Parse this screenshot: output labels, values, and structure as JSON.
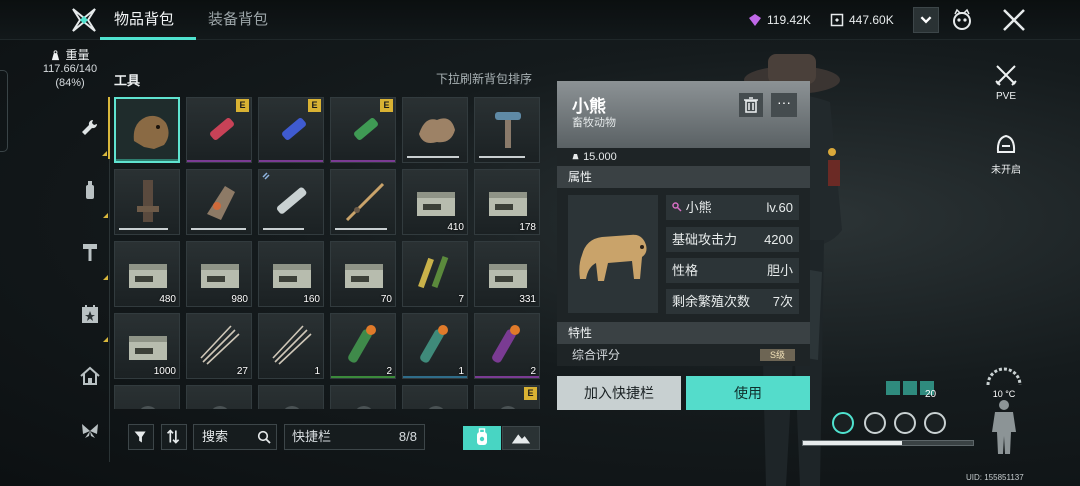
{
  "header": {
    "tabs": [
      "物品背包",
      "装备背包"
    ],
    "active_tab": 0,
    "currency1": "119.42K",
    "currency2": "447.60K"
  },
  "sidebar": {
    "weight_label": "重量",
    "weight_value": "117.66/140",
    "weight_percent": "(84%)",
    "categories": [
      "wrench-icon",
      "bottle-icon",
      "hammer-icon",
      "calendar-star-icon",
      "house-icon",
      "butterfly-icon"
    ],
    "active_category": 0
  },
  "inventory": {
    "section_title": "工具",
    "refresh_hint": "下拉刷新背包排序",
    "slots": [
      {
        "icon": "bear-head",
        "selected": true,
        "rarity": "#2f7d6f"
      },
      {
        "icon": "vial-red",
        "badge": "E",
        "rarity": "#7a3b93"
      },
      {
        "icon": "vial-blue",
        "badge": "E",
        "rarity": "#7a3b93"
      },
      {
        "icon": "vial-green",
        "badge": "E",
        "rarity": "#7a3b93"
      },
      {
        "icon": "fur-pelt",
        "durability": 0.9
      },
      {
        "icon": "pickaxe-tool",
        "durability": 0.8
      },
      {
        "icon": "spear-rack",
        "durability": 0.85
      },
      {
        "icon": "gauntlet",
        "durability": 0.95
      },
      {
        "icon": "chainsaw",
        "durability": 0.7,
        "link": true
      },
      {
        "icon": "fishing-rod",
        "durability": 0.9
      },
      {
        "icon": "ammo-box",
        "count": "410"
      },
      {
        "icon": "ammo-box",
        "count": "178"
      },
      {
        "icon": "ammo-box",
        "count": "480"
      },
      {
        "icon": "ammo-box",
        "count": "980"
      },
      {
        "icon": "ammo-box",
        "count": "160"
      },
      {
        "icon": "ammo-box",
        "count": "70"
      },
      {
        "icon": "shells",
        "count": "7"
      },
      {
        "icon": "ammo-box",
        "count": "331"
      },
      {
        "icon": "ammo-box",
        "count": "1000"
      },
      {
        "icon": "arrows",
        "count": "27"
      },
      {
        "icon": "arrows",
        "count": "1"
      },
      {
        "icon": "flare-green",
        "count": "2",
        "rarity": "#3b8a3b"
      },
      {
        "icon": "flare-teal",
        "count": "1",
        "rarity": "#2f6d8a"
      },
      {
        "icon": "flare-purple",
        "count": "2",
        "rarity": "#7a3b93"
      },
      {
        "icon": "misc",
        "durability": 0
      },
      {
        "icon": "misc",
        "durability": 0
      },
      {
        "icon": "misc",
        "durability": 0
      },
      {
        "icon": "misc",
        "durability": 0
      },
      {
        "icon": "misc",
        "durability": 0
      },
      {
        "icon": "misc",
        "badge": "E",
        "durability": 0
      }
    ]
  },
  "toolbar": {
    "search_label": "搜索",
    "quickbar_label": "快捷栏",
    "quickbar_count": "8/8"
  },
  "detail": {
    "name": "小熊",
    "category": "畜牧动物",
    "weight": "15.000",
    "attr_header": "属性",
    "attributes": [
      {
        "label": "小熊",
        "value": "lv.60"
      },
      {
        "label": "基础攻击力",
        "value": "4200"
      },
      {
        "label": "性格",
        "value": "胆小"
      },
      {
        "label": "剩余繁殖次数",
        "value": "7次"
      }
    ],
    "trait_header": "特性",
    "score_label": "综合评分",
    "grade": "S级",
    "add_quick_label": "加入快捷栏",
    "use_label": "使用",
    "more_label": "···"
  },
  "hud": {
    "pve_label": "PVE",
    "unopened_label": "未开启",
    "temperature": "10 °C",
    "buff_count": "20",
    "stamina": 0.58,
    "uid": "UID: 155851137"
  },
  "colors": {
    "accent": "#4fe2cf",
    "badge_e": "#d9b233",
    "rare_purple": "#7a3b93"
  }
}
